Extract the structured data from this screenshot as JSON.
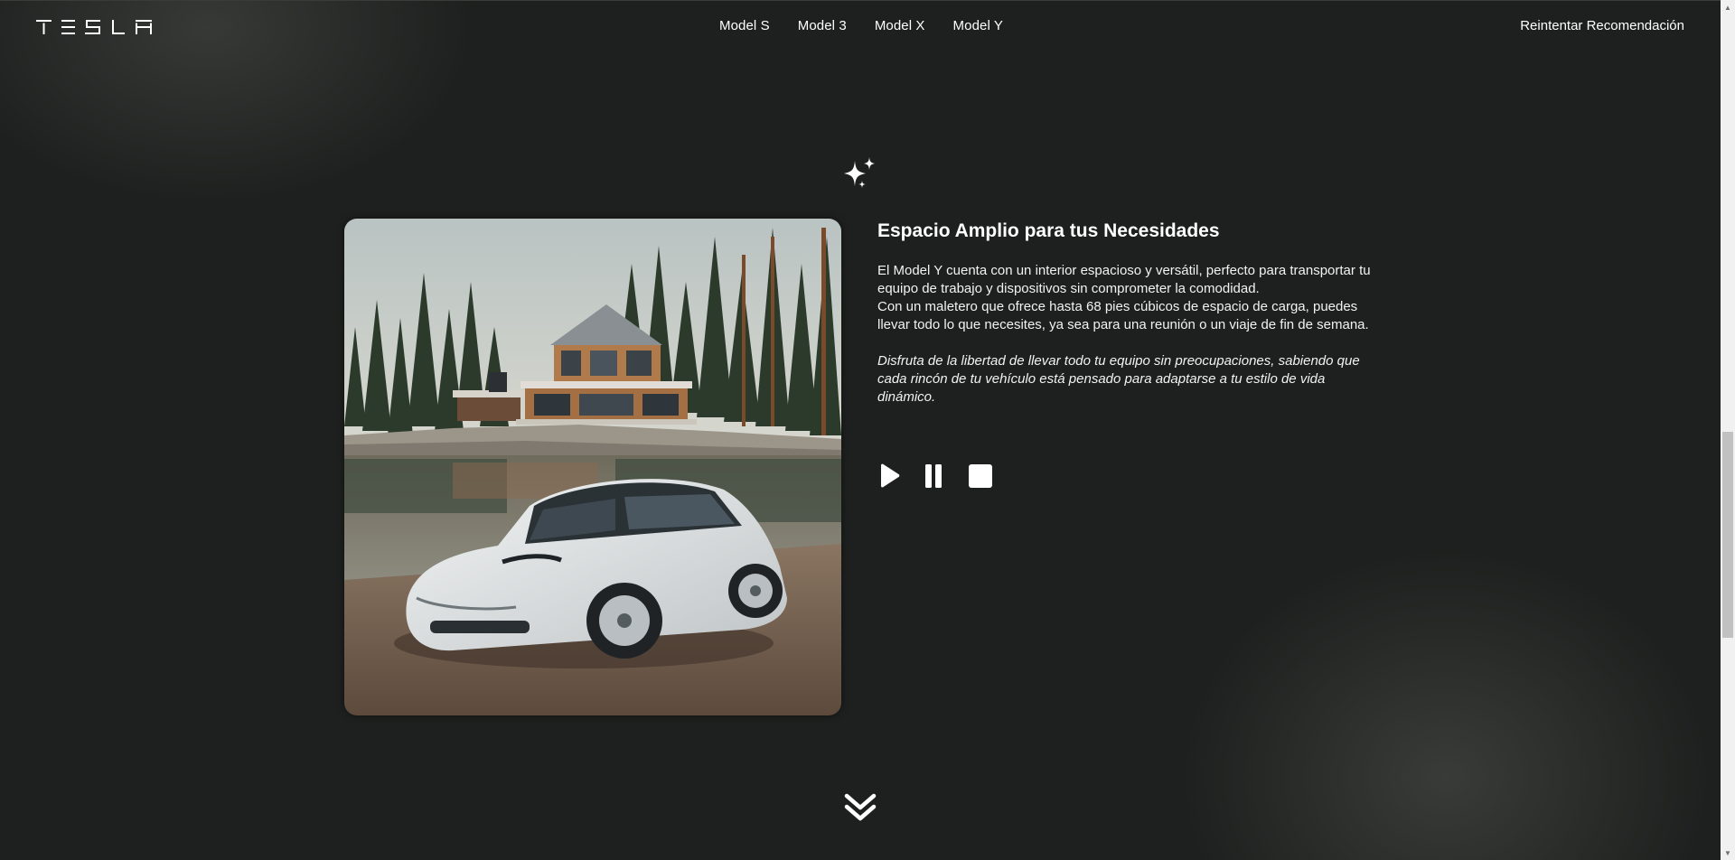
{
  "brand": {
    "logo_text": "TESLA",
    "logo_icon": "tesla-wordmark"
  },
  "nav": {
    "items": [
      {
        "label": "Model S"
      },
      {
        "label": "Model 3"
      },
      {
        "label": "Model X"
      },
      {
        "label": "Model Y"
      }
    ],
    "retry_label": "Reintentar Recomendación"
  },
  "feature": {
    "icon": "sparkle-icon",
    "title": "Espacio Amplio para tus Necesidades",
    "paragraph_1": "El Model Y cuenta con un interior espacioso y versátil, perfecto para transportar tu equipo de trabajo y dispositivos sin comprometer la comodidad.",
    "paragraph_2": "Con un maletero que ofrece hasta 68 pies cúbicos de espacio de carga, puedes llevar todo lo que necesites, ya sea para una reunión o un viaje de fin de semana.",
    "paragraph_italic": "Disfruta de la libertad de llevar todo tu equipo sin preocupaciones, sabiendo que cada rincón de tu vehículo está pensado para adaptarse a tu estilo de vida dinámico.",
    "image_alt": "white Tesla Model Y parked by a lake in front of a modern house in a pine forest"
  },
  "audio_controls": {
    "play_icon": "play-icon",
    "pause_icon": "pause-icon",
    "stop_icon": "stop-icon"
  },
  "scroll_hint_icon": "double-chevron-down-icon",
  "colors": {
    "background": "#1d201e",
    "text": "#ffffff",
    "scrollbar_track": "#f1f1f1",
    "scrollbar_thumb": "#c1c1c1"
  }
}
